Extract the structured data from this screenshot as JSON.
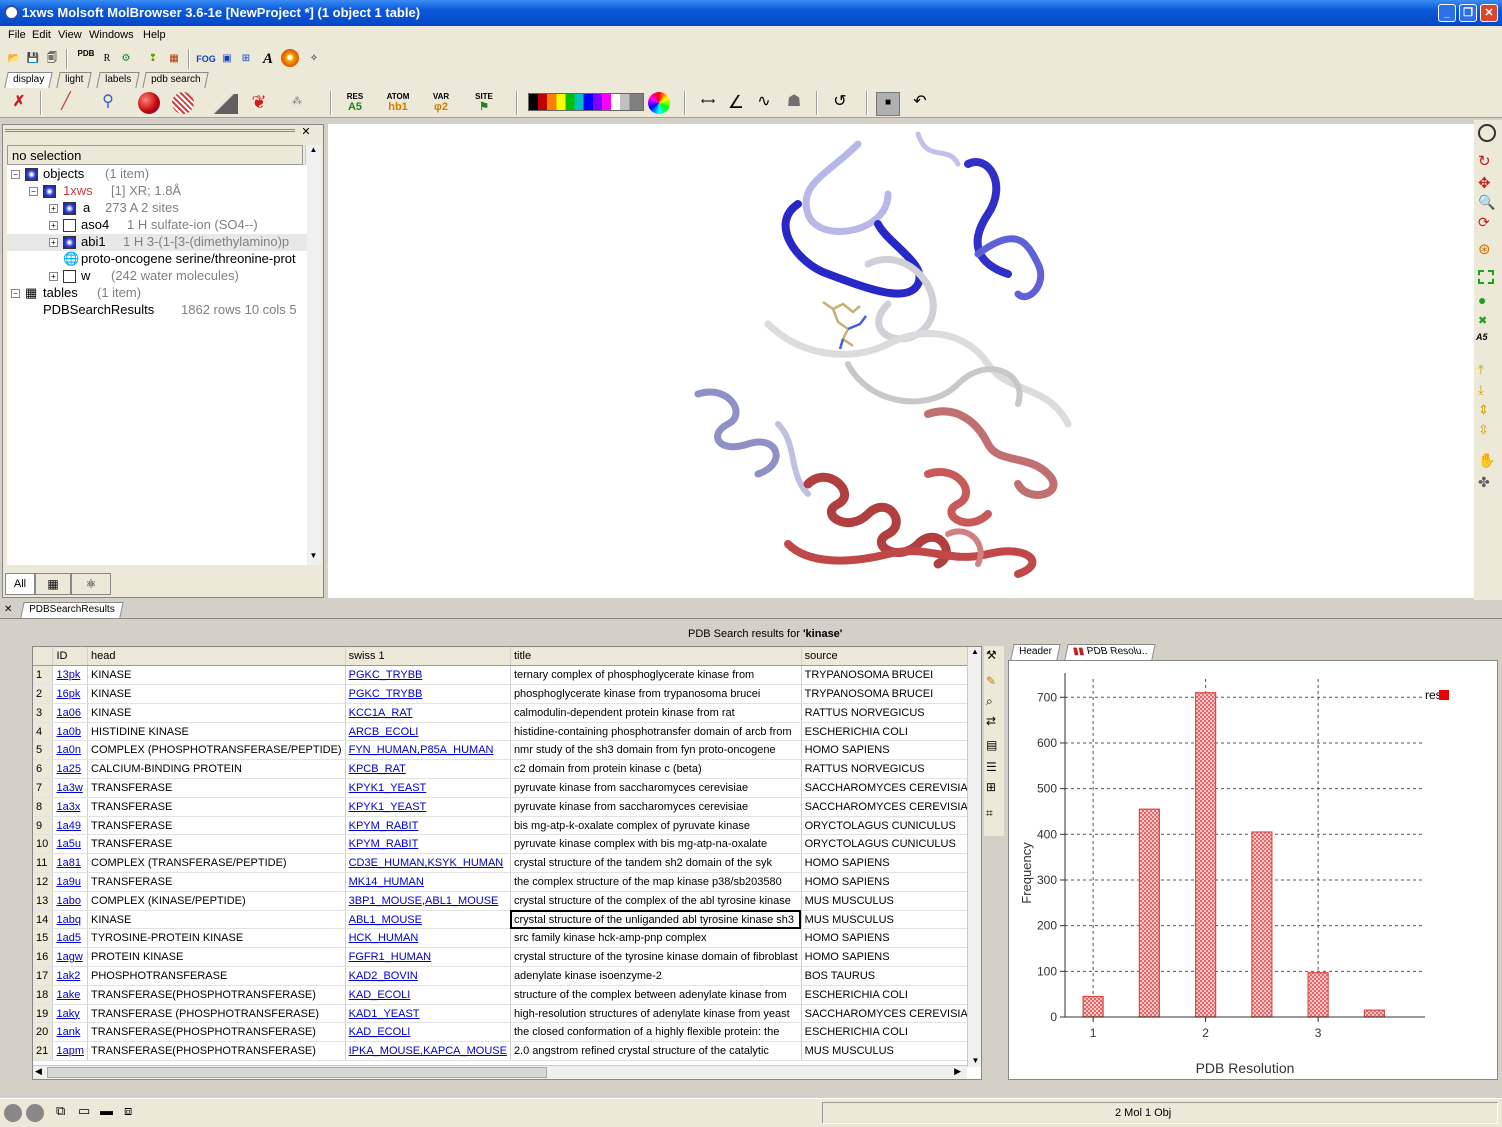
{
  "window": {
    "title": "1xws Molsoft MolBrowser 3.6-1e  [NewProject *] (1 object 1 table)"
  },
  "menu": [
    "File",
    "Edit",
    "View",
    "Windows",
    "Help"
  ],
  "toolbar_tabs": [
    "display",
    "light",
    "labels",
    "pdb search"
  ],
  "toolbar_labels": {
    "res": "RES",
    "res_sub": "A5",
    "atom": "ATOM",
    "atom_sub": "hb1",
    "var": "VAR",
    "var_sub": "φ2",
    "site": "SITE",
    "pdb": "PDB",
    "fog": "FOG"
  },
  "left_panel": {
    "selection": "no selection",
    "tree": [
      {
        "label": "objects",
        "info": "(1 item)"
      },
      {
        "label": "1xws",
        "info": "[1] XR; 1.8Å"
      },
      {
        "label": "a",
        "info": "273 A  2 sites"
      },
      {
        "label": "aso4",
        "info": "1 H   sulfate-ion (SO4--)"
      },
      {
        "label": "abi1",
        "info": "1 H   3-(1-[3-(dimethylamino)p"
      },
      {
        "label": "proto-oncogene serine/threonine-prot",
        "info": ""
      },
      {
        "label": "w",
        "info": "(242 water molecules)"
      },
      {
        "label": "tables",
        "info": "(1 item)"
      },
      {
        "label": "PDBSearchResults",
        "info": "1862 rows 10 cols 5"
      }
    ],
    "bottom_tabs": [
      "All"
    ]
  },
  "results": {
    "tab": "PDBSearchResults",
    "caption_prefix": "PDB Search results for ",
    "caption_query": "'kinase'",
    "columns": [
      "",
      "ID",
      "head",
      "swiss 1",
      "title",
      "source"
    ],
    "rows": [
      [
        "1",
        "13pk",
        "KINASE",
        "PGKC_TRYBB",
        "ternary complex of phosphoglycerate kinase from",
        "TRYPANOSOMA BRUCEI"
      ],
      [
        "2",
        "16pk",
        "KINASE",
        "PGKC_TRYBB",
        "phosphoglycerate kinase from trypanosoma brucei",
        "TRYPANOSOMA BRUCEI"
      ],
      [
        "3",
        "1a06",
        "KINASE",
        "KCC1A_RAT",
        "calmodulin-dependent protein kinase from rat",
        "RATTUS NORVEGICUS"
      ],
      [
        "4",
        "1a0b",
        "HISTIDINE KINASE",
        "ARCB_ECOLI",
        "histidine-containing phosphotransfer domain of arcb from",
        "ESCHERICHIA COLI"
      ],
      [
        "5",
        "1a0n",
        "COMPLEX (PHOSPHOTRANSFERASE/PEPTIDE)",
        "FYN_HUMAN,P85A_HUMAN",
        "nmr study of the sh3 domain from fyn proto-oncogene",
        "HOMO SAPIENS"
      ],
      [
        "6",
        "1a25",
        "CALCIUM-BINDING PROTEIN",
        "KPCB_RAT",
        "c2 domain from protein kinase c (beta)",
        "RATTUS NORVEGICUS"
      ],
      [
        "7",
        "1a3w",
        "TRANSFERASE",
        "KPYK1_YEAST",
        "pyruvate kinase from saccharomyces cerevisiae",
        "SACCHAROMYCES CEREVISIAE"
      ],
      [
        "8",
        "1a3x",
        "TRANSFERASE",
        "KPYK1_YEAST",
        "pyruvate kinase from saccharomyces cerevisiae",
        "SACCHAROMYCES CEREVISIAE"
      ],
      [
        "9",
        "1a49",
        "TRANSFERASE",
        "KPYM_RABIT",
        "bis mg-atp-k-oxalate complex of pyruvate kinase",
        "ORYCTOLAGUS CUNICULUS"
      ],
      [
        "10",
        "1a5u",
        "TRANSFERASE",
        "KPYM_RABIT",
        "pyruvate kinase complex with bis mg-atp-na-oxalate",
        "ORYCTOLAGUS CUNICULUS"
      ],
      [
        "11",
        "1a81",
        "COMPLEX (TRANSFERASE/PEPTIDE)",
        "CD3E_HUMAN,KSYK_HUMAN",
        "crystal structure of the tandem sh2 domain of the syk",
        "HOMO SAPIENS"
      ],
      [
        "12",
        "1a9u",
        "TRANSFERASE",
        "MK14_HUMAN",
        "the complex structure of the map kinase p38/sb203580",
        "HOMO SAPIENS"
      ],
      [
        "13",
        "1abo",
        "COMPLEX (KINASE/PEPTIDE)",
        "3BP1_MOUSE,ABL1_MOUSE",
        "crystal structure of the complex of the abl tyrosine kinase",
        "MUS MUSCULUS"
      ],
      [
        "14",
        "1abq",
        "KINASE",
        "ABL1_MOUSE",
        "crystal structure of the unliganded abl tyrosine kinase sh3",
        "MUS MUSCULUS"
      ],
      [
        "15",
        "1ad5",
        "TYROSINE-PROTEIN KINASE",
        "HCK_HUMAN",
        "src family kinase hck-amp-pnp complex",
        "HOMO SAPIENS"
      ],
      [
        "16",
        "1agw",
        "PROTEIN KINASE",
        "FGFR1_HUMAN",
        "crystal structure of the tyrosine kinase domain of fibroblast",
        "HOMO SAPIENS"
      ],
      [
        "17",
        "1ak2",
        "PHOSPHOTRANSFERASE",
        "KAD2_BOVIN",
        "adenylate kinase isoenzyme-2",
        "BOS TAURUS"
      ],
      [
        "18",
        "1ake",
        "TRANSFERASE(PHOSPHOTRANSFERASE)",
        "KAD_ECOLI",
        "structure of the complex between adenylate kinase from",
        "ESCHERICHIA COLI"
      ],
      [
        "19",
        "1aky",
        "TRANSFERASE (PHOSPHOTRANSFERASE)",
        "KAD1_YEAST",
        "high-resolution structures of adenylate kinase from yeast",
        "SACCHAROMYCES CEREVISIAE"
      ],
      [
        "20",
        "1ank",
        "TRANSFERASE(PHOSPHOTRANSFERASE)",
        "KAD_ECOLI",
        "the closed conformation of a highly flexible protein: the",
        "ESCHERICHIA COLI"
      ],
      [
        "21",
        "1apm",
        "TRANSFERASE(PHOSPHOTRANSFERASE)",
        "IPKA_MOUSE,KAPCA_MOUSE",
        "2.0 angstrom refined crystal structure of the catalytic",
        "MUS MUSCULUS"
      ]
    ]
  },
  "plot_tabs": [
    "Header",
    "PDB Resolu.."
  ],
  "chart_data": {
    "type": "bar",
    "x": [
      1.0,
      1.5,
      2.0,
      2.5,
      3.0,
      3.5
    ],
    "series": [
      {
        "name": "res",
        "values": [
          45,
          455,
          710,
          405,
          97,
          15
        ]
      }
    ],
    "xlabel": "PDB Resolution",
    "ylabel": "Frequency",
    "xticks": [
      "1",
      "2",
      "3"
    ],
    "yticks": [
      "0",
      "100",
      "200",
      "300",
      "400",
      "500",
      "600",
      "700"
    ],
    "ylim": [
      0,
      740
    ],
    "xlim": [
      0.75,
      3.95
    ],
    "grid": true,
    "legend": "top-right",
    "color": "#e04848"
  },
  "status": {
    "right": "2 Mol 1 Obj"
  }
}
